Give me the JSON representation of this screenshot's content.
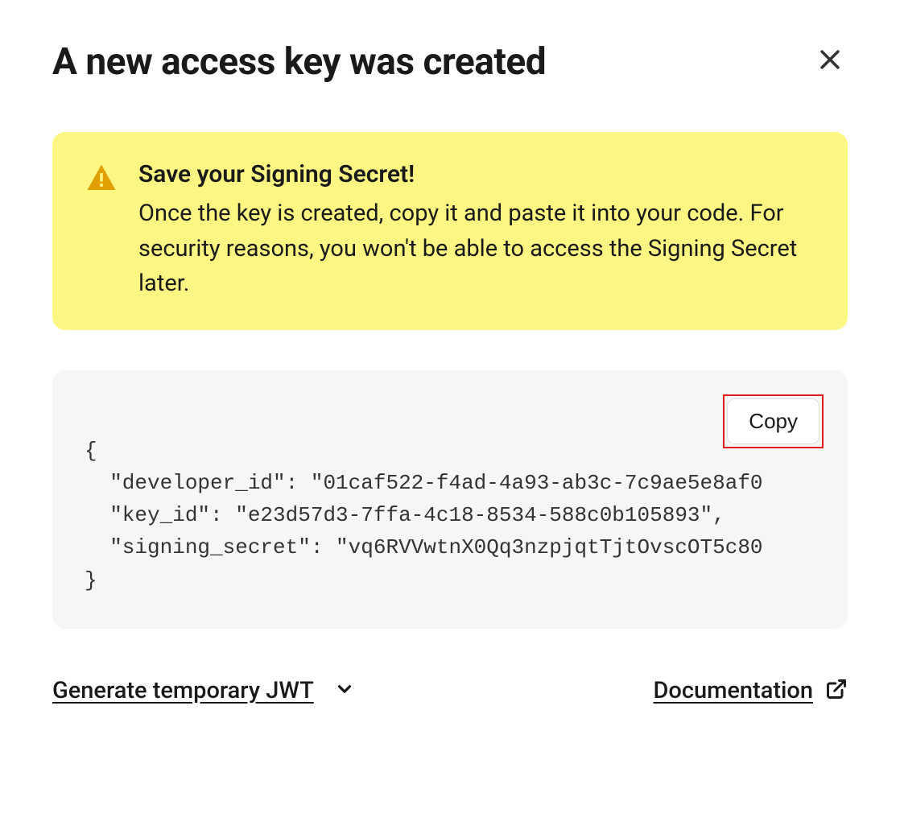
{
  "header": {
    "title": "A new access key was created"
  },
  "warning": {
    "title": "Save your Signing Secret!",
    "text": "Once the key is created, copy it and paste it into your code. For security reasons, you won't be able to access the Signing Secret later."
  },
  "code": {
    "copy_label": "Copy",
    "content": "{\n  \"developer_id\": \"01caf522-f4ad-4a93-ab3c-7c9ae5e8af0\n  \"key_id\": \"e23d57d3-7ffa-4c18-8534-588c0b105893\",\n  \"signing_secret\": \"vq6RVVwtnX0Qq3nzpjqtTjtOvscOT5c80\n}"
  },
  "footer": {
    "jwt_label": "Generate temporary JWT",
    "doc_label": "Documentation"
  }
}
